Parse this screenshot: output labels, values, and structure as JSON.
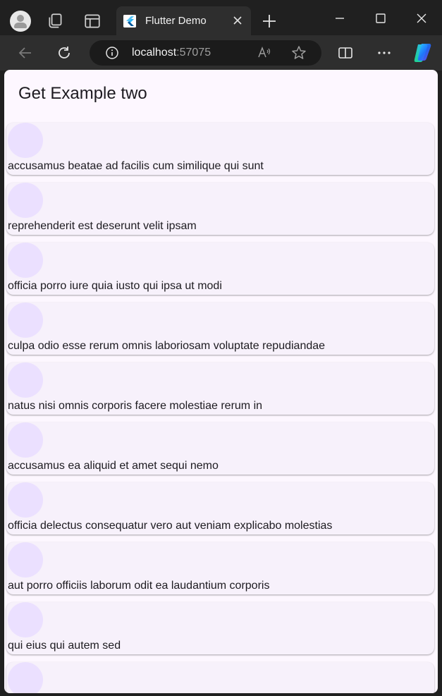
{
  "browser": {
    "tab_title": "Flutter Demo",
    "url_host": "localhost",
    "url_port": ":57075"
  },
  "app": {
    "title": "Get Example two",
    "accent_color": "#ebe0ff",
    "items": [
      "accusamus beatae ad facilis cum similique qui sunt",
      "reprehenderit est deserunt velit ipsam",
      "officia porro iure quia iusto qui ipsa ut modi",
      "culpa odio esse rerum omnis laboriosam voluptate repudiandae",
      "natus nisi omnis corporis facere molestiae rerum in",
      "accusamus ea aliquid et amet sequi nemo",
      "officia delectus consequatur vero aut veniam explicabo molestias",
      "aut porro officiis laborum odit ea laudantium corporis",
      "qui eius qui autem sed"
    ]
  }
}
